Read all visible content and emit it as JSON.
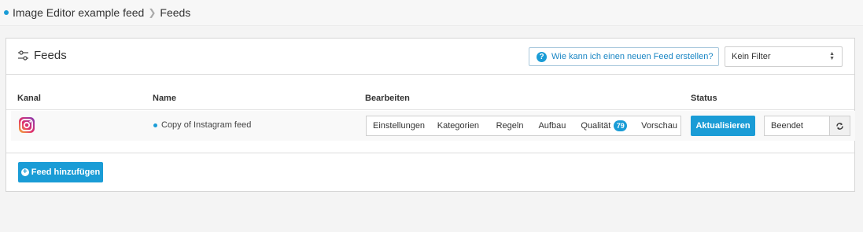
{
  "breadcrumb": {
    "items": [
      "Image Editor example feed",
      "Feeds"
    ]
  },
  "panel": {
    "title": "Feeds",
    "help_label": "Wie kann ich einen neuen Feed erstellen?",
    "filter_value": "Kein Filter"
  },
  "table": {
    "headers": [
      "Kanal",
      "Name",
      "Bearbeiten",
      "Status"
    ],
    "rows": [
      {
        "channel_icon": "instagram-icon",
        "name": "Copy of Instagram feed",
        "edit_tabs": [
          "Einstellungen",
          "Kategorien",
          "Regeln",
          "Aufbau",
          "Qualität",
          "Vorschau"
        ],
        "quality_score": "79",
        "update_label": "Aktualisieren",
        "status": "Beendet"
      }
    ]
  },
  "add_feed_label": "Feed hinzufügen",
  "colors": {
    "accent": "#1a9cd6",
    "panel_border": "#d6d6d6",
    "background": "#f4f4f4"
  }
}
